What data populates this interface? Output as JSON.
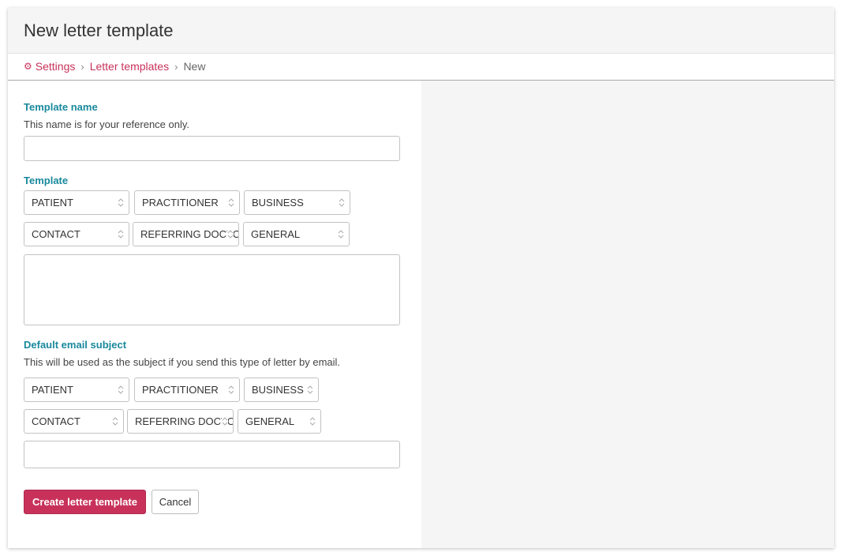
{
  "header": {
    "title": "New letter template"
  },
  "breadcrumb": {
    "settings_icon": "gear-icon",
    "items": [
      {
        "label": "Settings"
      },
      {
        "label": "Letter templates"
      },
      {
        "label": "New"
      }
    ]
  },
  "form": {
    "template_name": {
      "label": "Template name",
      "help": "This name is for your reference only.",
      "value": ""
    },
    "template": {
      "label": "Template",
      "selects": [
        "PATIENT",
        "PRACTITIONER",
        "BUSINESS",
        "CONTACT",
        "REFERRING DOCTOR",
        "GENERAL"
      ],
      "body": ""
    },
    "email_subject": {
      "label": "Default email subject",
      "help": "This will be used as the subject if you send this type of letter by email.",
      "selects": [
        "PATIENT",
        "PRACTITIONER",
        "BUSINESS",
        "CONTACT",
        "REFERRING DOCTOR",
        "GENERAL"
      ],
      "value": ""
    }
  },
  "actions": {
    "create_label": "Create letter template",
    "cancel_label": "Cancel"
  },
  "colors": {
    "accent": "#c8325a",
    "label": "#19899c",
    "panel_bg": "#f5f5f5"
  }
}
